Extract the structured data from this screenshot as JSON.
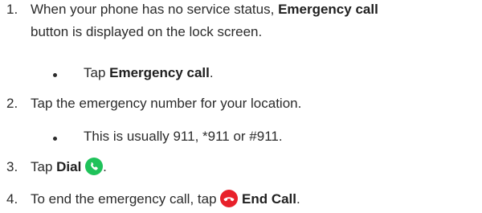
{
  "steps": [
    {
      "num": "1.",
      "line1_pre": "When your phone has no service status, ",
      "line1_bold": "Emergency call",
      "line2": "button is displayed on the lock screen.",
      "sub_pre": "Tap ",
      "sub_bold": "Emergency call",
      "sub_post": "."
    },
    {
      "num": "2.",
      "text": "Tap the emergency number for your location.",
      "sub": "This is usually 911, *911 or #911."
    },
    {
      "num": "3.",
      "pre": "Tap ",
      "bold": "Dial",
      "icon": "phone-dial-icon",
      "post": "."
    },
    {
      "num": "4.",
      "pre": "To end the emergency call, tap ",
      "icon": "end-call-icon",
      "bold": "End Call",
      "post": "."
    }
  ],
  "colors": {
    "dial_icon": "#1fc25a",
    "end_call_icon": "#e8202a",
    "text": "#2b2b2b"
  }
}
